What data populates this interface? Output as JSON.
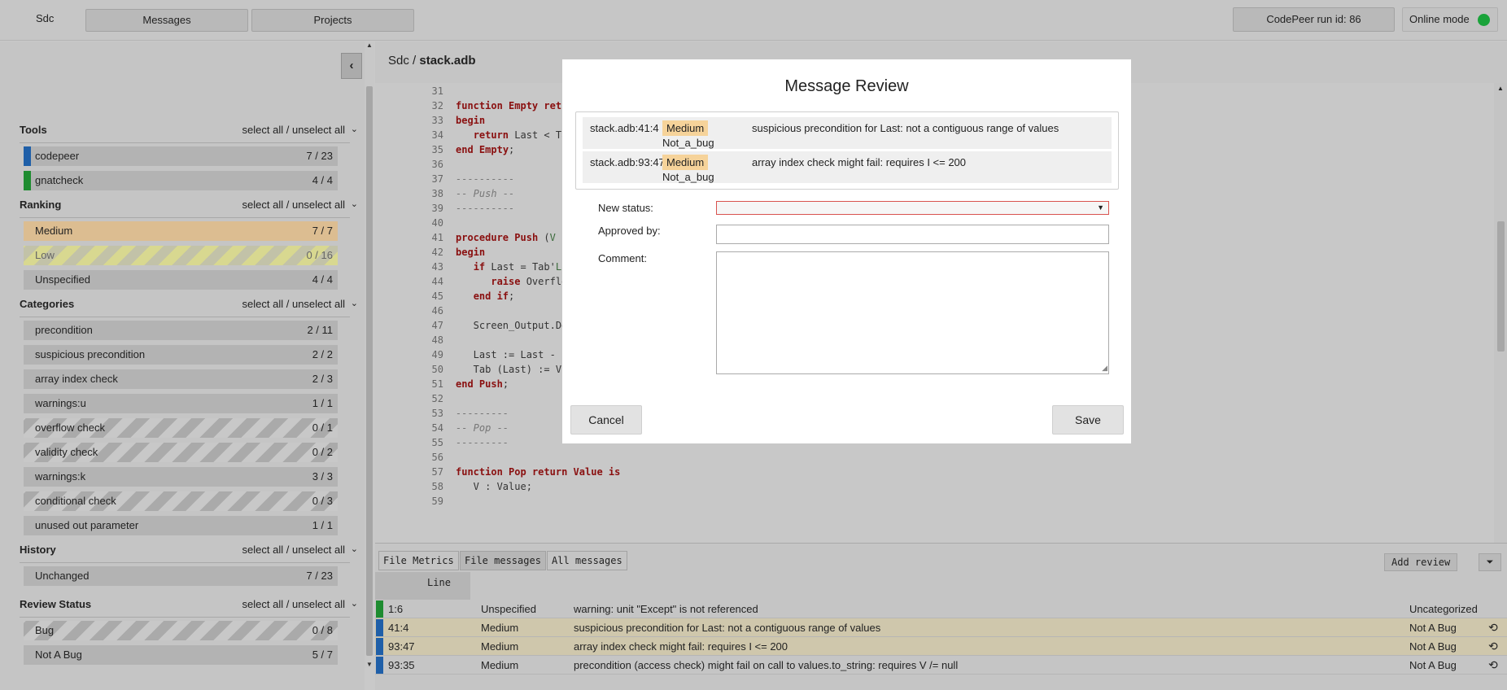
{
  "topbar": {
    "brand": "Sdc",
    "messages_label": "Messages",
    "projects_label": "Projects",
    "run_id": "CodePeer run id: 86",
    "online_mode": "Online mode"
  },
  "sidebar": {
    "collapse_icon": "chevron-left-icon",
    "select_all": "select all / unselect all",
    "sections": {
      "tools": {
        "title": "Tools",
        "items": [
          {
            "label": "codepeer",
            "count": "7 / 23",
            "color": "#1f5fa8"
          },
          {
            "label": "gnatcheck",
            "count": "4 / 4",
            "color": "#1e8c30"
          }
        ]
      },
      "ranking": {
        "title": "Ranking",
        "items": [
          {
            "label": "Medium",
            "count": "7 / 7"
          },
          {
            "label": "Low",
            "count": "0 / 16"
          },
          {
            "label": "Unspecified",
            "count": "4 / 4"
          }
        ]
      },
      "categories": {
        "title": "Categories",
        "items": [
          {
            "label": "precondition",
            "count": "2 / 11"
          },
          {
            "label": "suspicious precondition",
            "count": "2 / 2"
          },
          {
            "label": "array index check",
            "count": "2 / 3"
          },
          {
            "label": "warnings:u",
            "count": "1 / 1"
          },
          {
            "label": "overflow check",
            "count": "0 / 1"
          },
          {
            "label": "validity check",
            "count": "0 / 2"
          },
          {
            "label": "warnings:k",
            "count": "3 / 3"
          },
          {
            "label": "conditional check",
            "count": "0 / 3"
          },
          {
            "label": "unused out parameter",
            "count": "1 / 1"
          }
        ]
      },
      "history": {
        "title": "History",
        "items": [
          {
            "label": "Unchanged",
            "count": "7 / 23"
          }
        ]
      },
      "review_status": {
        "title": "Review Status",
        "items": [
          {
            "label": "Bug",
            "count": "0 / 8"
          },
          {
            "label": "Not A Bug",
            "count": "5 / 7"
          }
        ]
      }
    }
  },
  "main": {
    "path_prefix": "Sdc / ",
    "path_file": "stack.adb",
    "code": {
      "lines": [
        {
          "n": "31",
          "t": ""
        },
        {
          "n": "32",
          "t": "   function Empty retu"
        },
        {
          "n": "33",
          "t": "   begin"
        },
        {
          "n": "34",
          "t": "      return Last < Ta"
        },
        {
          "n": "35",
          "t": "   end Empty;"
        },
        {
          "n": "36",
          "t": ""
        },
        {
          "n": "37",
          "t": "   ----------"
        },
        {
          "n": "38",
          "t": "   -- Push --"
        },
        {
          "n": "39",
          "t": "   ----------"
        },
        {
          "n": "40",
          "t": ""
        },
        {
          "n": "41",
          "t": "   procedure Push (V"
        },
        {
          "n": "42",
          "t": "   begin"
        },
        {
          "n": "43",
          "t": "      if Last = Tab'La"
        },
        {
          "n": "44",
          "t": "         raise Overflo"
        },
        {
          "n": "45",
          "t": "      end if;"
        },
        {
          "n": "46",
          "t": ""
        },
        {
          "n": "47",
          "t": "      Screen_Output.De"
        },
        {
          "n": "48",
          "t": ""
        },
        {
          "n": "49",
          "t": "      Last := Last - "
        },
        {
          "n": "50",
          "t": "      Tab (Last) := V"
        },
        {
          "n": "51",
          "t": "   end Push;"
        },
        {
          "n": "52",
          "t": ""
        },
        {
          "n": "53",
          "t": "   ---------"
        },
        {
          "n": "54",
          "t": "   -- Pop --"
        },
        {
          "n": "55",
          "t": "   ---------"
        },
        {
          "n": "56",
          "t": ""
        },
        {
          "n": "57",
          "t": "   function Pop return Value is"
        },
        {
          "n": "58",
          "t": "      V : Value;"
        },
        {
          "n": "59",
          "t": ""
        }
      ]
    },
    "tabs": {
      "file_metrics": "File Metrics",
      "file_messages": "File messages",
      "all_messages": "All messages",
      "add_review": "Add review",
      "collapse_icon": "double-chevron-down-icon"
    },
    "table": {
      "line_header": "Line",
      "rows": [
        {
          "line": "1:6",
          "rank": "Unspecified",
          "msg": "warning: unit \"Except\" is not referenced",
          "review": "Uncategorized",
          "color": "#1e8c30",
          "highlight": false
        },
        {
          "line": "41:4",
          "rank": "Medium",
          "msg": "suspicious precondition for Last: not a contiguous range of values",
          "review": "Not A Bug",
          "color": "#1f5fa8",
          "highlight": true
        },
        {
          "line": "93:47",
          "rank": "Medium",
          "msg": "array index check might fail: requires I <= 200",
          "review": "Not A Bug",
          "color": "#1f5fa8",
          "highlight": true
        },
        {
          "line": "93:35",
          "rank": "Medium",
          "msg": "precondition (access check) might fail on call to values.to_string: requires V /= null",
          "review": "Not A Bug",
          "color": "#1f5fa8",
          "highlight": false
        }
      ]
    }
  },
  "modal": {
    "title": "Message Review",
    "items": [
      {
        "file": "stack.adb:41:4",
        "rank": "Medium",
        "status": "Not_a_bug",
        "desc": "suspicious precondition for Last: not a contiguous range of values"
      },
      {
        "file": "stack.adb:93:47",
        "rank": "Medium",
        "status": "Not_a_bug",
        "desc": "array index check might fail: requires I <= 200"
      }
    ],
    "new_status_label": "New status:",
    "new_status_value": "",
    "approved_by_label": "Approved by:",
    "approved_by_value": "",
    "comment_label": "Comment:",
    "comment_value": "",
    "cancel_label": "Cancel",
    "save_label": "Save"
  }
}
